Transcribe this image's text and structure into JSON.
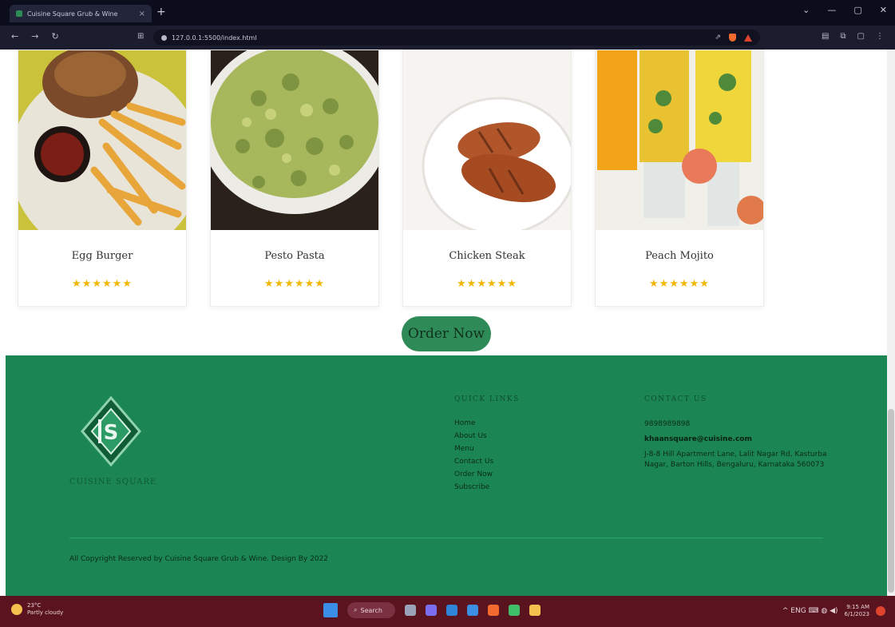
{
  "browser": {
    "tab_title": "Cuisine Square Grub & Wine",
    "tab_close": "×",
    "new_tab": "+",
    "url": "127.0.0.1:5500/index.html",
    "win_controls": [
      "⌄",
      "—",
      "▢",
      "✕"
    ],
    "nav": [
      "←",
      "→",
      "↻"
    ],
    "bookmark": "⊞",
    "share": "⇗",
    "right_tools": [
      "▤",
      "⧉",
      "▢",
      "⋮"
    ]
  },
  "cards": [
    {
      "name": "Egg Burger",
      "stars": "★★★★★★"
    },
    {
      "name": "Pesto Pasta",
      "stars": "★★★★★★"
    },
    {
      "name": "Chicken Steak",
      "stars": "★★★★★★"
    },
    {
      "name": "Peach Mojito",
      "stars": "★★★★★★"
    }
  ],
  "order_button": "Order Now",
  "footer": {
    "logo_text": "CUISINE SQUARE",
    "quick_links_title": "QUICK LINKS",
    "quick_links": [
      "Home",
      "About Us",
      "Menu",
      "Contact Us",
      "Order Now",
      "Subscribe"
    ],
    "contact_title": "CONTACT US",
    "contact": {
      "phone": "9898989898",
      "email": "khaansquare@cuisine.com",
      "address": "J-8-8 Hill Apartment Lane, Lalit Nagar Rd, Kasturba Nagar, Barton Hills, Bengaluru, Karnataka 560073"
    },
    "copyright": "All Copyright Reserved by Cuisine Square Grub & Wine. Design By 2022"
  },
  "taskbar": {
    "weather_temp": "23°C",
    "weather_desc": "Partly cloudy",
    "search_label": "Search",
    "tray": "^ ENG ⌨ ◍ ◀)",
    "time": "9:15 AM",
    "date": "6/1/2023"
  },
  "colors": {
    "footer_green": "#1b8653",
    "button_green": "#2e8b57",
    "star_gold": "#f2b705",
    "taskbar": "#5a1420"
  }
}
